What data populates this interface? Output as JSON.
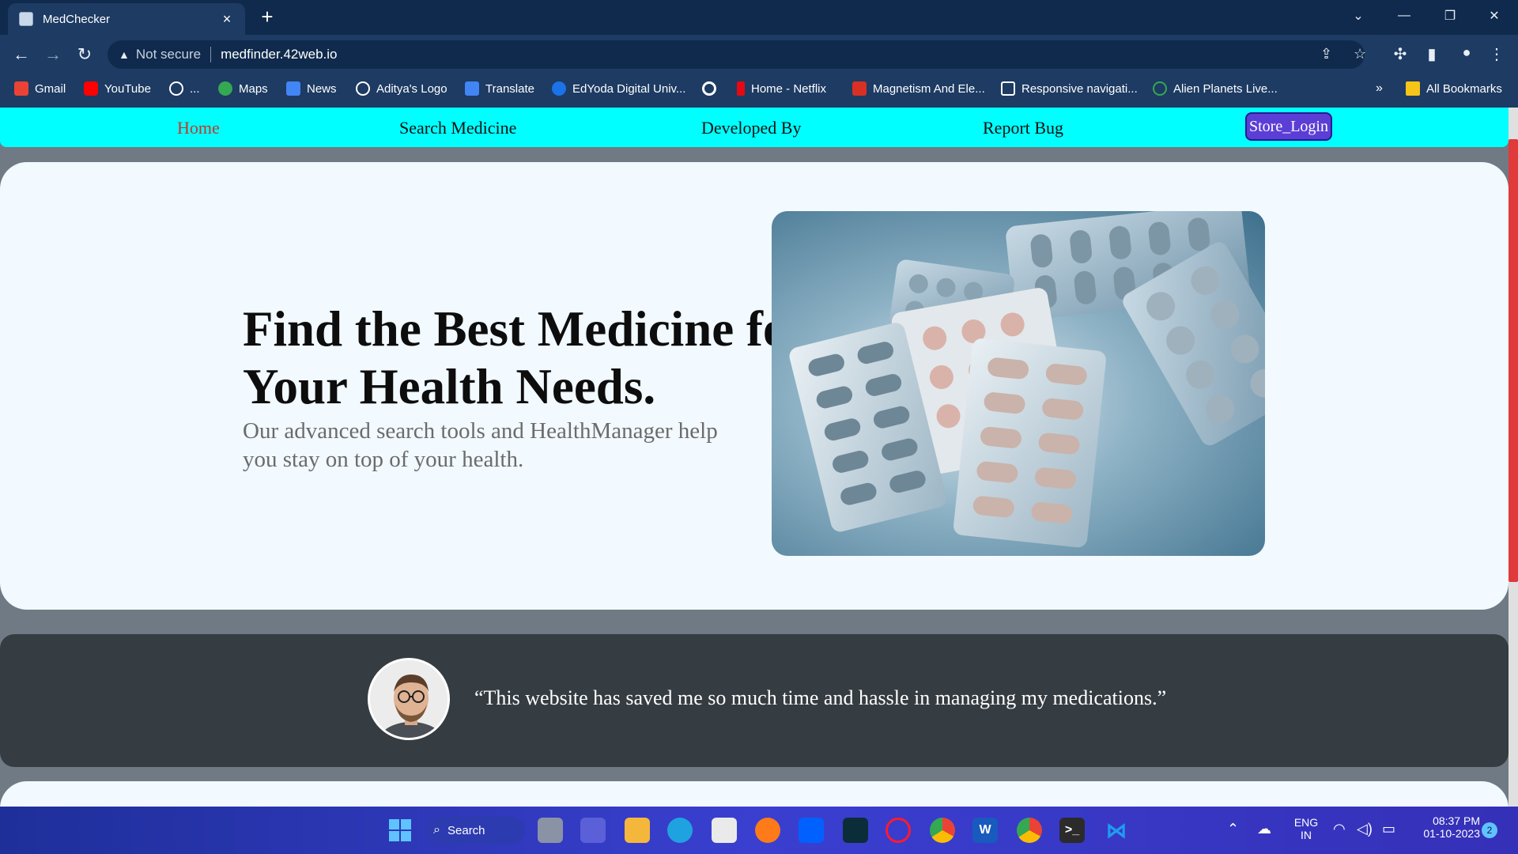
{
  "browser": {
    "tab_title": "MedChecker",
    "tab_close": "×",
    "new_tab": "+",
    "not_secure": "Not secure",
    "url": "medfinder.42web.io"
  },
  "bookmarks": [
    {
      "label": "Gmail",
      "icon": "gmail-icon",
      "color": "#ea4335"
    },
    {
      "label": "YouTube",
      "icon": "youtube-icon",
      "color": "#ff0000"
    },
    {
      "label": "...",
      "icon": "globe-icon",
      "color": "#ffffff"
    },
    {
      "label": "Maps",
      "icon": "maps-icon",
      "color": "#34a853"
    },
    {
      "label": "News",
      "icon": "news-icon",
      "color": "#4285f4"
    },
    {
      "label": "Aditya's Logo",
      "icon": "globe-icon",
      "color": "#ffffff"
    },
    {
      "label": "Translate",
      "icon": "translate-icon",
      "color": "#4285f4"
    },
    {
      "label": "EdYoda Digital Univ...",
      "icon": "edyoda-icon",
      "color": "#1a73e8"
    },
    {
      "label": "",
      "icon": "google-icon",
      "color": "#ffffff"
    },
    {
      "label": "Home - Netflix",
      "icon": "netflix-icon",
      "color": "#e50914"
    },
    {
      "label": "Magnetism And Ele...",
      "icon": "magnet-icon",
      "color": "#d93025"
    },
    {
      "label": "Responsive navigati...",
      "icon": "codepen-icon",
      "color": "#ffffff"
    },
    {
      "label": "Alien Planets Live...",
      "icon": "planet-icon",
      "color": "#34a853"
    }
  ],
  "all_bookmarks": "All Bookmarks",
  "nav": {
    "home": "Home",
    "search": "Search Medicine",
    "developed": "Developed By",
    "report": "Report Bug",
    "store_login": "Store_Login"
  },
  "hero": {
    "title": "Find the Best Medicine for Your Health Needs.",
    "subtitle": "Our advanced search tools and HealthManager help you stay on top of your health."
  },
  "testimonial": {
    "quote": "“This website has saved me so much time and hassle in managing my medications.”"
  },
  "taskbar": {
    "search": "Search",
    "lang_top": "ENG",
    "lang_bottom": "IN",
    "time": "08:37 PM",
    "date": "01-10-2023",
    "notifications": "2"
  },
  "colors": {
    "nav_bg": "#00ffff",
    "active_link": "#c0392b",
    "store_btn": "#5b3ed6",
    "hero_bg": "#f2f9ff",
    "testimonial_bg": "#353c42"
  }
}
